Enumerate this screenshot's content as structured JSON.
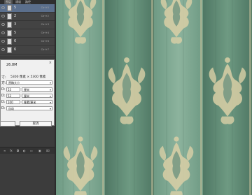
{
  "layers_panel": {
    "tabs": [
      "图层",
      "通道",
      "路径"
    ],
    "rows": [
      {
        "name": "5",
        "tag": "Ctrl+5"
      },
      {
        "name": "2",
        "tag": "Ctrl+2"
      },
      {
        "name": "3",
        "tag": "Ctrl+3"
      },
      {
        "name": "5",
        "tag": "Ctrl+4"
      },
      {
        "name": "6",
        "tag": "Ctrl+6"
      },
      {
        "name": "6",
        "tag": "Ctrl+7"
      }
    ]
  },
  "dialog": {
    "close": "×",
    "size_text": "26.8M",
    "row1_label": "寸:",
    "row1_value": "5300 像素 × 5300 像素",
    "row2_label": "方:",
    "row2_value": "原稿大小",
    "row3_label": "D:",
    "row3_input": "53",
    "row3_unit": "厘米",
    "row4_label": "D:",
    "row4_input": "53",
    "row4_unit": "厘米",
    "row5_label": "D:",
    "row5_input": "100",
    "row5_unit": "像素/厘米",
    "row6_label": "D:",
    "row6_value": "自动",
    "ok_label": "",
    "cancel_label": "取消"
  },
  "bottom_bar": {
    "icons": [
      "link-icon",
      "fx-icon",
      "mask-icon",
      "adjust-icon",
      "folder-icon",
      "new-layer-icon",
      "trash-icon"
    ]
  },
  "colors": {
    "stripe_dark": "#5d8672",
    "stripe_light": "#7aa38c",
    "ornament": "#dcd3ad",
    "highlight": "#5b6f8c"
  }
}
